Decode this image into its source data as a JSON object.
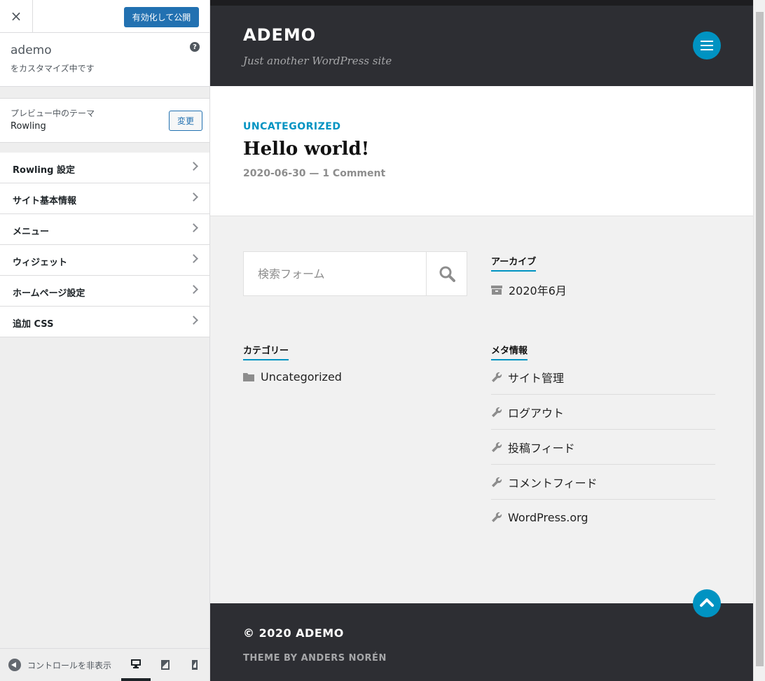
{
  "customizer": {
    "close_icon": "×",
    "publish_label": "有効化して公開",
    "site_name": "ademo",
    "site_subtitle": "をカスタマイズ中です",
    "help_icon": "?",
    "theme_label": "プレビュー中のテーマ",
    "theme_name": "Rowling",
    "change_label": "変更",
    "panels": [
      {
        "label": "Rowling 設定"
      },
      {
        "label": "サイト基本情報"
      },
      {
        "label": "メニュー"
      },
      {
        "label": "ウィジェット"
      },
      {
        "label": "ホームページ設定"
      },
      {
        "label": "追加 CSS"
      }
    ],
    "hide_controls_label": "コントロールを非表示"
  },
  "preview": {
    "site_title": "ADEMO",
    "site_description": "Just another WordPress site",
    "post": {
      "category": "UNCATEGORIZED",
      "title": "Hello world!",
      "date": "2020-06-30",
      "separator": " — ",
      "comments": "1 Comment"
    },
    "search_placeholder": "検索フォーム",
    "archives": {
      "title": "アーカイブ",
      "items": [
        "2020年6月"
      ]
    },
    "categories": {
      "title": "カテゴリー",
      "items": [
        "Uncategorized"
      ]
    },
    "meta": {
      "title": "メタ情報",
      "items": [
        "サイト管理",
        "ログアウト",
        "投稿フィード",
        "コメントフィード",
        "WordPress.org"
      ]
    },
    "footer": {
      "copyright": "© 2020 ADEMO",
      "theme_by": "THEME BY ANDERS NORÉN"
    }
  },
  "colors": {
    "accent": "#0093c2",
    "header_bg": "#2d2e33",
    "publish_button": "#2271b1"
  }
}
